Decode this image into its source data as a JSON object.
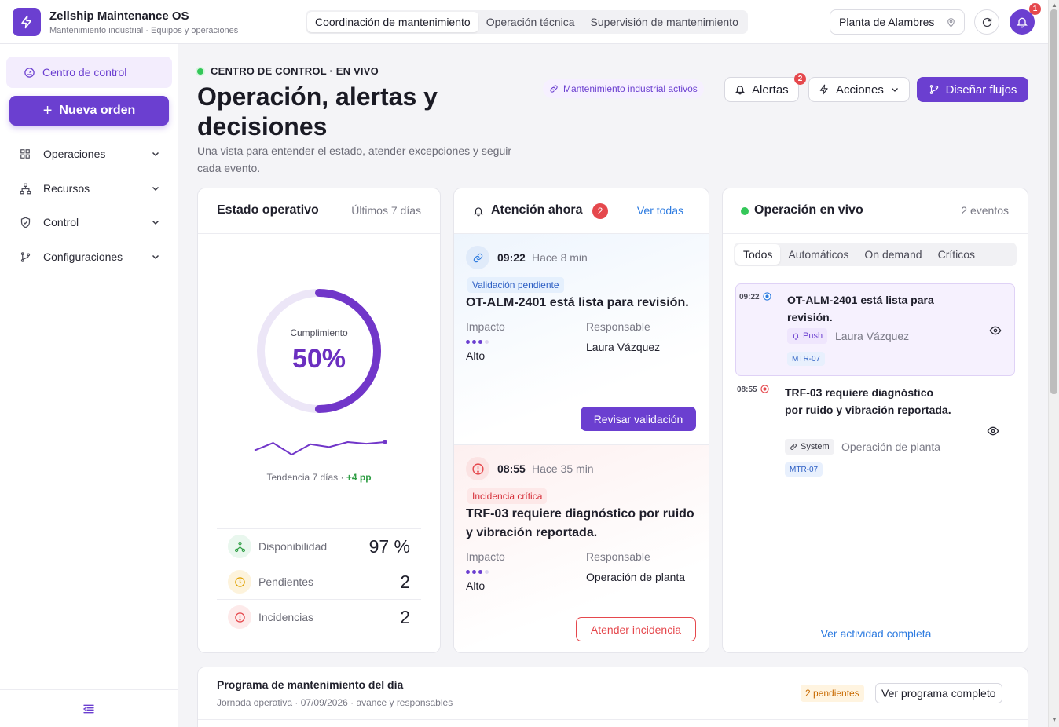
{
  "app": {
    "title": "Zellship Maintenance OS",
    "subtitle": "Mantenimiento industrial · Equipos y operaciones",
    "notification_count": "1"
  },
  "modes": [
    "Coordinación de mantenimiento",
    "Operación técnica",
    "Supervisión de mantenimiento"
  ],
  "active_mode": "Coordinación de mantenimiento",
  "plant": "Planta de Alambres",
  "sidebar": {
    "active": "Centro de control",
    "new_order": "Nueva orden",
    "items": [
      {
        "label": "Operaciones",
        "icon": "grid-icon"
      },
      {
        "label": "Recursos",
        "icon": "hierarchy-icon"
      },
      {
        "label": "Control",
        "icon": "shield-check-icon"
      },
      {
        "label": "Configuraciones",
        "icon": "branch-icon"
      }
    ]
  },
  "header": {
    "eyebrow": "CENTRO DE CONTROL · EN VIVO",
    "title": "Operación, alertas y decisiones",
    "description": "Una vista para entender el estado, atender excepciones y seguir cada evento.",
    "active_chip": "Mantenimiento industrial activos",
    "alerts_label": "Alertas",
    "alerts_count": "2",
    "actions_label": "Acciones",
    "design_label": "Diseñar flujos"
  },
  "state_card": {
    "title": "Estado operativo",
    "period": "Últimos 7 días",
    "gauge_label": "Cumplimiento",
    "gauge_value": "50%",
    "gauge_fraction": 0.5,
    "trend_label": "Tendencia 7 días ·",
    "trend_delta": "+4 pp",
    "sparkline": [
      40,
      58,
      30,
      55,
      48,
      60,
      56,
      60
    ],
    "kpis": [
      {
        "label": "Disponibilidad",
        "value": "97 %",
        "icon": "network-icon",
        "color": "#2f9e44"
      },
      {
        "label": "Pendientes",
        "value": "2",
        "icon": "clock-icon",
        "color": "#e0a100"
      },
      {
        "label": "Incidencias",
        "value": "2",
        "icon": "alert-circle-icon",
        "color": "#e5484d"
      }
    ]
  },
  "attention": {
    "title": "Atención ahora",
    "count": "2",
    "see_all": "Ver todas",
    "impact_label": "Impacto",
    "owner_label": "Responsable",
    "items": [
      {
        "time": "09:22",
        "ago": "Hace 8 min",
        "tag": "Validación pendiente",
        "title": "OT-ALM-2401 está lista para revisión.",
        "impact": "Alto",
        "impact_level": 3,
        "owner": "Laura Vázquez",
        "action": "Revisar validación"
      },
      {
        "time": "08:55",
        "ago": "Hace 35 min",
        "tag": "Incidencia crítica",
        "title": "TRF-03 requiere diagnóstico por ruido y vibración reportada.",
        "impact": "Alto",
        "impact_level": 3,
        "owner": "Operación de planta",
        "action": "Atender incidencia"
      }
    ]
  },
  "live": {
    "title": "Operación en vivo",
    "count": "2 eventos",
    "filters": [
      "Todos",
      "Automáticos",
      "On demand",
      "Críticos"
    ],
    "active_filter": "Todos",
    "events": [
      {
        "time": "09:22",
        "title": "OT-ALM-2401 está lista para revisión.",
        "channel": "Push",
        "who": "Laura Vázquez",
        "code": "MTR-07"
      },
      {
        "time": "08:55",
        "title": "TRF-03 requiere diagnóstico por ruido y vibración reportada.",
        "channel": "System",
        "who": "Operación de planta",
        "code": "MTR-07"
      }
    ],
    "see_all": "Ver actividad completa"
  },
  "program": {
    "title": "Programa de mantenimiento del día",
    "subtitle": "Jornada operativa · 07/09/2026 · avance y responsables",
    "pending": "2 pendientes",
    "see_all": "Ver programa completo"
  },
  "colors": {
    "accent": "#6b3fd0",
    "danger": "#e5484d",
    "success": "#34c759",
    "info": "#2d5fc4"
  }
}
